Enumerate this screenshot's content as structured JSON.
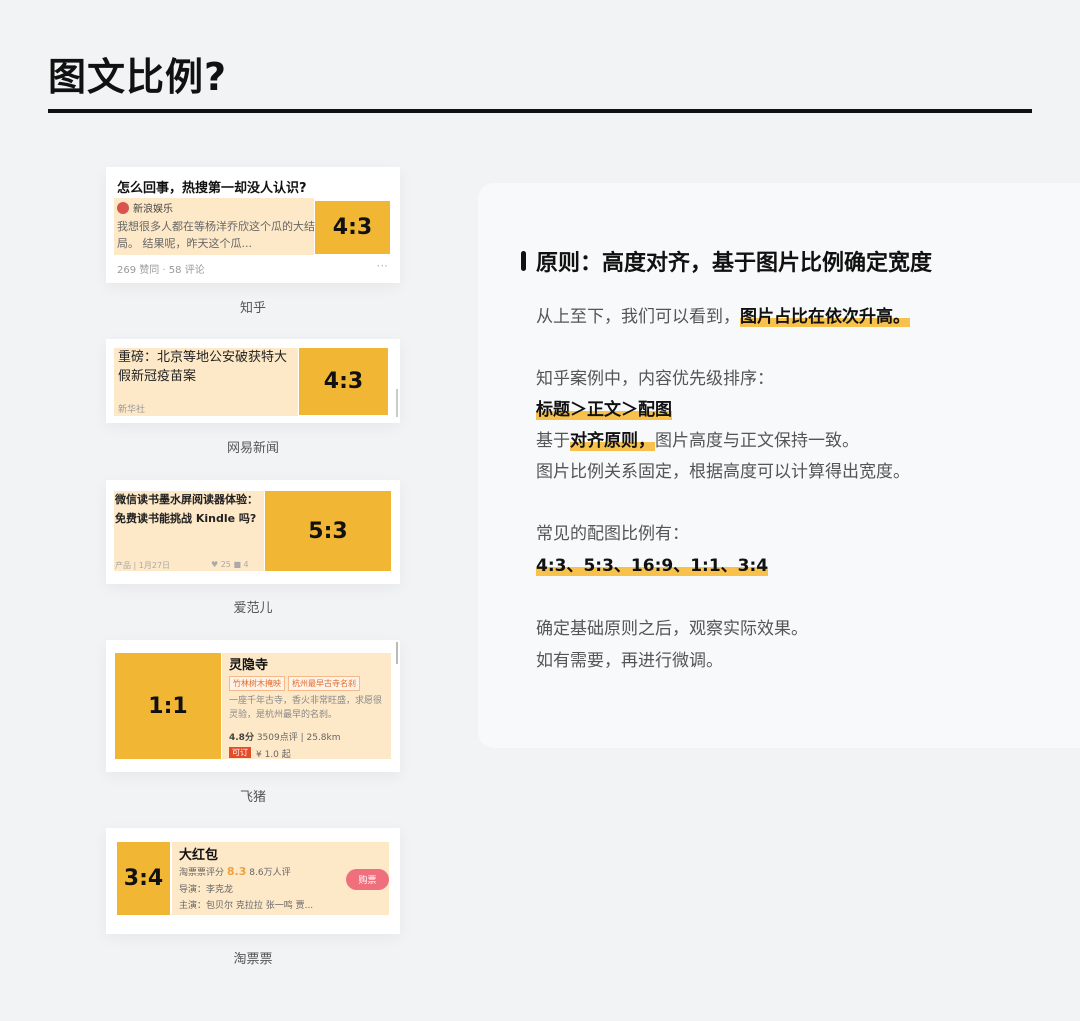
{
  "page": {
    "title": "图文比例?"
  },
  "cards": {
    "zhihu": {
      "title": "怎么回事，热搜第一却没人认识?",
      "source": "新浪娱乐",
      "body": "我想很多人都在等杨洋乔欣这个瓜的大结局。 结果呢，昨天这个瓜...",
      "meta": "269 赞同 · 58 评论",
      "more": "···",
      "ratio": "4:3",
      "caption": "知乎"
    },
    "wangyi": {
      "title": "重磅：北京等地公安破获特大假新冠疫苗案",
      "source": "新华社",
      "ratio": "4:3",
      "caption": "网易新闻"
    },
    "aifaner": {
      "title": "微信读书墨水屏阅读器体验：免费读书能挑战 Kindle 吗?",
      "meta": "产品 | 1月27日",
      "stats": "♥ 25  ■ 4",
      "ratio": "5:3",
      "caption": "爱范儿"
    },
    "feizhu": {
      "name": "灵隐寺",
      "tags": [
        "竹林树木掩映",
        "杭州最早古寺名刹"
      ],
      "desc": "一座千年古寺，香火非常旺盛，求愿很灵验，是杭州最早的名刹。",
      "score": "4.8分",
      "reviews": "3509点评 | 25.8km",
      "book_label": "可订",
      "price": "¥ 1.0 起",
      "ratio": "1:1",
      "caption": "飞猪"
    },
    "taopiaopiao": {
      "name": "大红包",
      "score_label": "淘票票评分",
      "score": "8.3",
      "score_count": "8.6万人评",
      "director": "导演：李克龙",
      "cast": "主演：包贝尔 克拉拉 张一鸣 贾...",
      "buy_label": "购票",
      "ratio": "3:4",
      "caption": "淘票票"
    }
  },
  "panel": {
    "heading": "原则：高度对齐，基于图片比例确定宽度",
    "line1_prefix": "从上至下，我们可以看到，",
    "line1_mark": "图片占比在依次升高。",
    "line2": "知乎案例中，内容优先级排序：",
    "line3_mark": "标题＞正文＞配图",
    "line4_prefix": "基于",
    "line4_mark": "对齐原则，",
    "line4_suffix": "图片高度与正文保持一致。",
    "line5": "图片比例关系固定，根据高度可以计算得出宽度。",
    "line6": "常见的配图比例有：",
    "line7_mark": "4:3、5:3、16:9、1:1、3:4",
    "line8": "确定基础原则之后，观察实际效果。",
    "line9": "如有需要，再进行微调。"
  },
  "colors": {
    "accent": "#f2b635",
    "highlight_bg": "#fde8c8",
    "marker": "#f7c14b"
  }
}
